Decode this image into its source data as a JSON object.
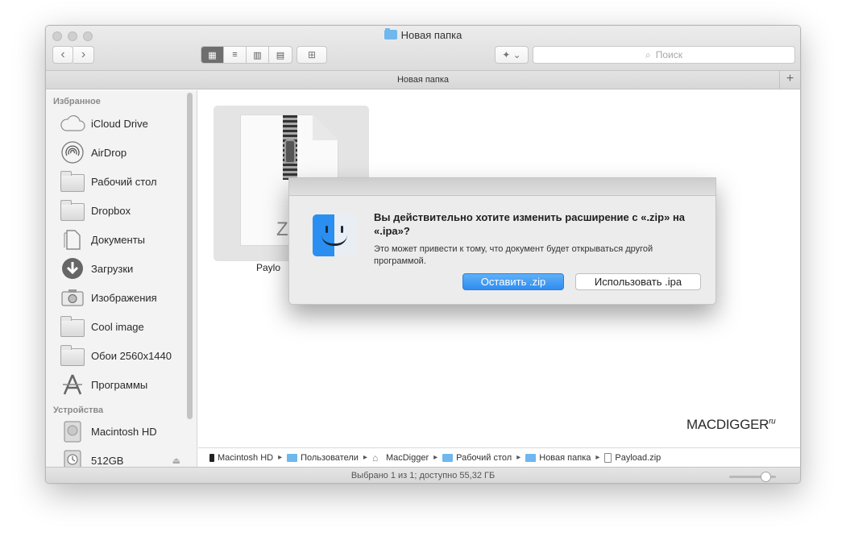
{
  "window": {
    "title": "Новая папка",
    "tab_title": "Новая папка"
  },
  "toolbar": {
    "back_label": "‹",
    "forward_label": "›",
    "view_icons_label": "▦",
    "view_list_label": "≡",
    "view_columns_label": "▥",
    "view_coverflow_label": "▤",
    "new_folder_label": "⊞",
    "dropbox_label": "✦ ⌄",
    "search_placeholder": "Поиск",
    "add_tab_label": "+"
  },
  "sidebar": {
    "favorites_header": "Избранное",
    "devices_header": "Устройства",
    "favorites": [
      {
        "label": "iCloud Drive",
        "icon": "cloud-icon"
      },
      {
        "label": "AirDrop",
        "icon": "airdrop-icon"
      },
      {
        "label": "Рабочий стол",
        "icon": "desktop-icon"
      },
      {
        "label": "Dropbox",
        "icon": "folder-icon"
      },
      {
        "label": "Документы",
        "icon": "documents-icon"
      },
      {
        "label": "Загрузки",
        "icon": "downloads-icon"
      },
      {
        "label": "Изображения",
        "icon": "camera-icon"
      },
      {
        "label": "Cool image",
        "icon": "folder-icon"
      },
      {
        "label": "Обои 2560x1440",
        "icon": "folder-icon"
      },
      {
        "label": "Программы",
        "icon": "applications-icon"
      }
    ],
    "devices": [
      {
        "label": "Macintosh HD",
        "icon": "harddisk-icon"
      },
      {
        "label": "512GB",
        "icon": "timemachine-icon"
      }
    ],
    "eject_label": "⏏"
  },
  "content": {
    "file_name": "Paylo",
    "file_ext_preview": "Z",
    "watermark_main": "MACDIGGER",
    "watermark_suffix": "ru"
  },
  "pathbar": {
    "crumbs": [
      "Macintosh HD",
      "Пользователи",
      "MacDigger",
      "Рабочий стол",
      "Новая папка",
      "Payload.zip"
    ],
    "separator": "▸"
  },
  "statusbar": {
    "text": "Выбрано 1 из 1; доступно 55,32 ГБ"
  },
  "dialog": {
    "title": "Вы действительно хотите изменить расширение с «.zip» на «.ipa»?",
    "message": "Это может привести к тому, что документ будет открываться другой программой.",
    "keep_button": "Оставить .zip",
    "use_button": "Использовать .ipa"
  },
  "colors": {
    "accent": "#3a95f2",
    "folder_blue": "#6fb7ee"
  }
}
